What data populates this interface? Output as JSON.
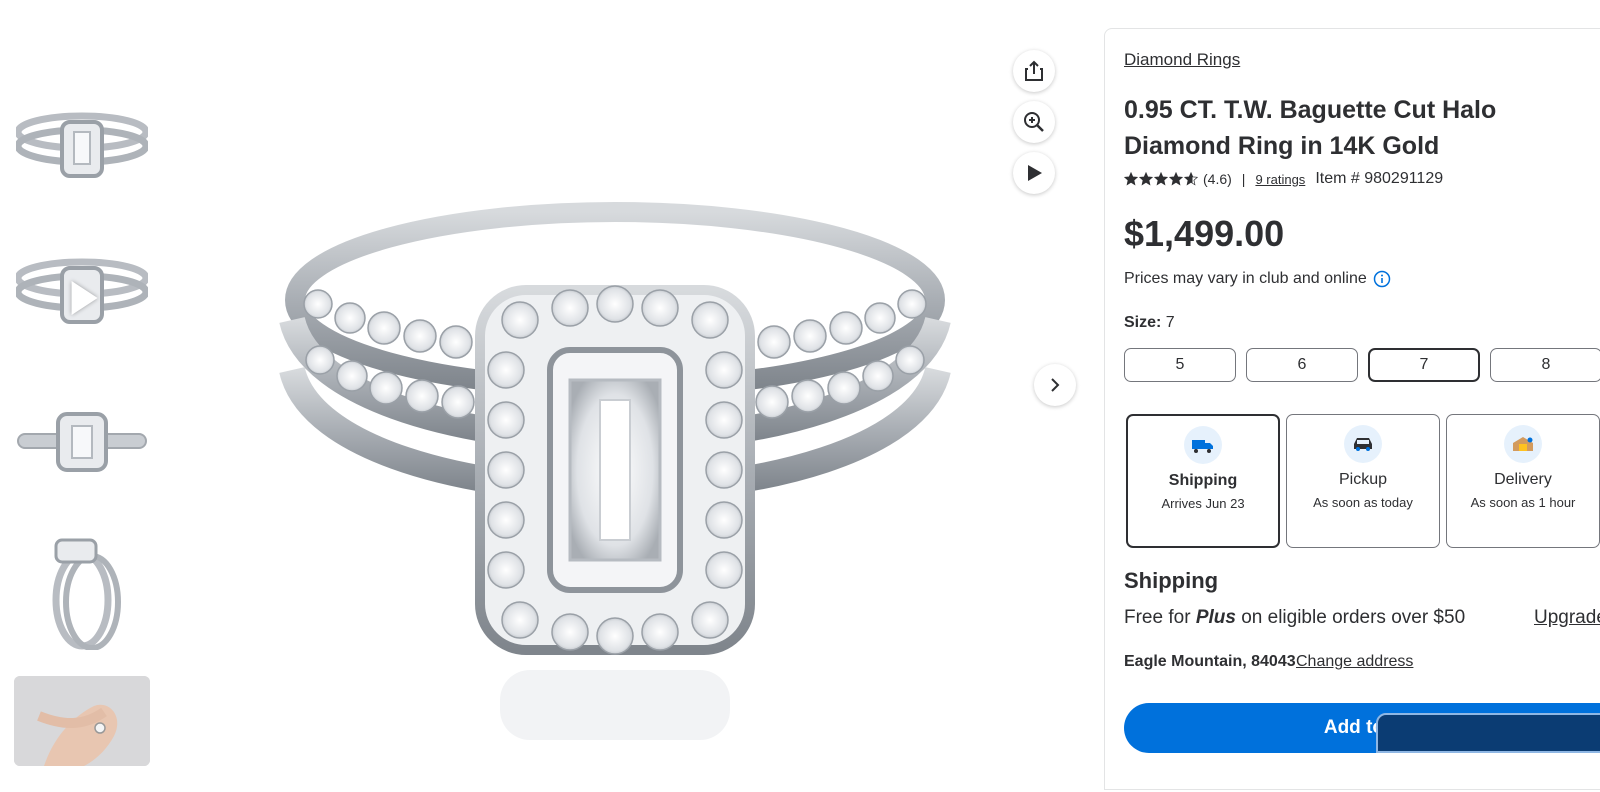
{
  "thumbnails": [
    {
      "name": "thumbnail-ring-front"
    },
    {
      "name": "thumbnail-ring-video"
    },
    {
      "name": "thumbnail-ring-top"
    },
    {
      "name": "thumbnail-ring-side"
    },
    {
      "name": "thumbnail-hand"
    }
  ],
  "tools": {
    "share_icon": "share-icon",
    "zoom_icon": "zoom-in-icon",
    "video_icon": "play-icon"
  },
  "product": {
    "breadcrumb": "Diamond Rings",
    "title": "0.95 CT. T.W. Baguette Cut Halo Diamond Ring in 14K Gold",
    "rating": "(4.6)",
    "rating_value": 4.6,
    "ratings_count": "9 ratings",
    "item_number": "Item # 980291129",
    "price": "$1,499.00",
    "price_note": "Prices may vary in club and online"
  },
  "size": {
    "label": "Size",
    "selected": "7",
    "options": [
      "5",
      "6",
      "7",
      "8"
    ]
  },
  "fulfillment": [
    {
      "title": "Shipping",
      "subtitle": "Arrives Jun 23",
      "selected": true
    },
    {
      "title": "Pickup",
      "subtitle": "As soon as today",
      "selected": false
    },
    {
      "title": "Delivery",
      "subtitle": "As soon as 1 hour",
      "selected": false
    }
  ],
  "shipping": {
    "heading": "Shipping",
    "free_prefix": "Free for",
    "plus": "Plus",
    "free_suffix": "on eligible orders over $50",
    "upgrade": "Upgrade",
    "address": "Eagle Mountain, 84043",
    "change": "Change address"
  },
  "cta": {
    "label": "Add to cart"
  },
  "colors": {
    "accent": "#0071dc",
    "text": "#2e2f32",
    "border": "#74767c"
  }
}
